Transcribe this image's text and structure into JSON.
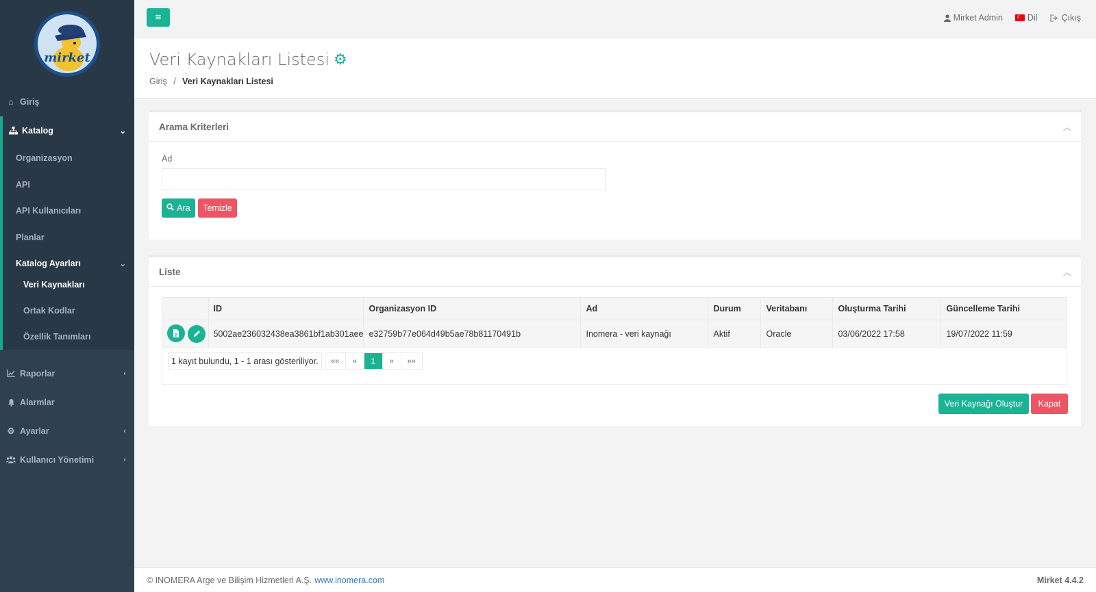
{
  "logo_text": "mirket",
  "sidebar": {
    "home": "Giriş",
    "catalog": "Katalog",
    "catalog_items": [
      "Organizasyon",
      "API",
      "API Kullanıcıları",
      "Planlar"
    ],
    "catalog_settings": "Katalog Ayarları",
    "catalog_settings_items": [
      "Veri Kaynakları",
      "Ortak Kodlar",
      "Özellik Tanımları"
    ],
    "reports": "Raporlar",
    "alarms": "Alarmlar",
    "settings": "Ayarlar",
    "users": "Kullanıcı Yönetimi"
  },
  "topbar": {
    "user": "Mirket Admin",
    "language": "Dil",
    "logout": "Çıkış"
  },
  "page": {
    "title": "Veri Kaynakları Listesi",
    "breadcrumb_home": "Giriş",
    "breadcrumb_separator": "/",
    "breadcrumb_current": "Veri Kaynakları Listesi"
  },
  "search": {
    "title": "Arama Kriterleri",
    "field_label": "Ad",
    "field_value": "",
    "search_button": "Ara",
    "clear_button": "Temizle"
  },
  "list": {
    "title": "Liste",
    "columns": [
      "",
      "ID",
      "Organizasyon ID",
      "Ad",
      "Durum",
      "Veritabanı",
      "Oluşturma Tarihi",
      "Güncelleme Tarihi"
    ],
    "rows": [
      {
        "id": "5002ae236032438ea3861bf1ab301aee",
        "org_id": "e32759b77e064d49b5ae78b81170491b",
        "name": "Inomera - veri kaynağı",
        "status": "Aktif",
        "database": "Oracle",
        "created": "03/06/2022 17:58",
        "updated": "19/07/2022 11:59"
      }
    ],
    "pager_info": "1 kayıt bulundu, 1 - 1 arası gösteriliyor.",
    "pager": {
      "first": "««",
      "prev": "«",
      "current": "1",
      "next": "»",
      "last": "»»"
    },
    "create_button": "Veri Kaynağı Oluştur",
    "close_button": "Kapat"
  },
  "footer": {
    "copyright": "© INOMERA Arge ve Bilişim Hizmetleri A.Ş.",
    "link": "www.inomera.com",
    "version": "Mirket 4.4.2"
  },
  "colors": {
    "sidebar": "#2f4050",
    "accent": "#1ab394",
    "danger": "#ed5565"
  }
}
